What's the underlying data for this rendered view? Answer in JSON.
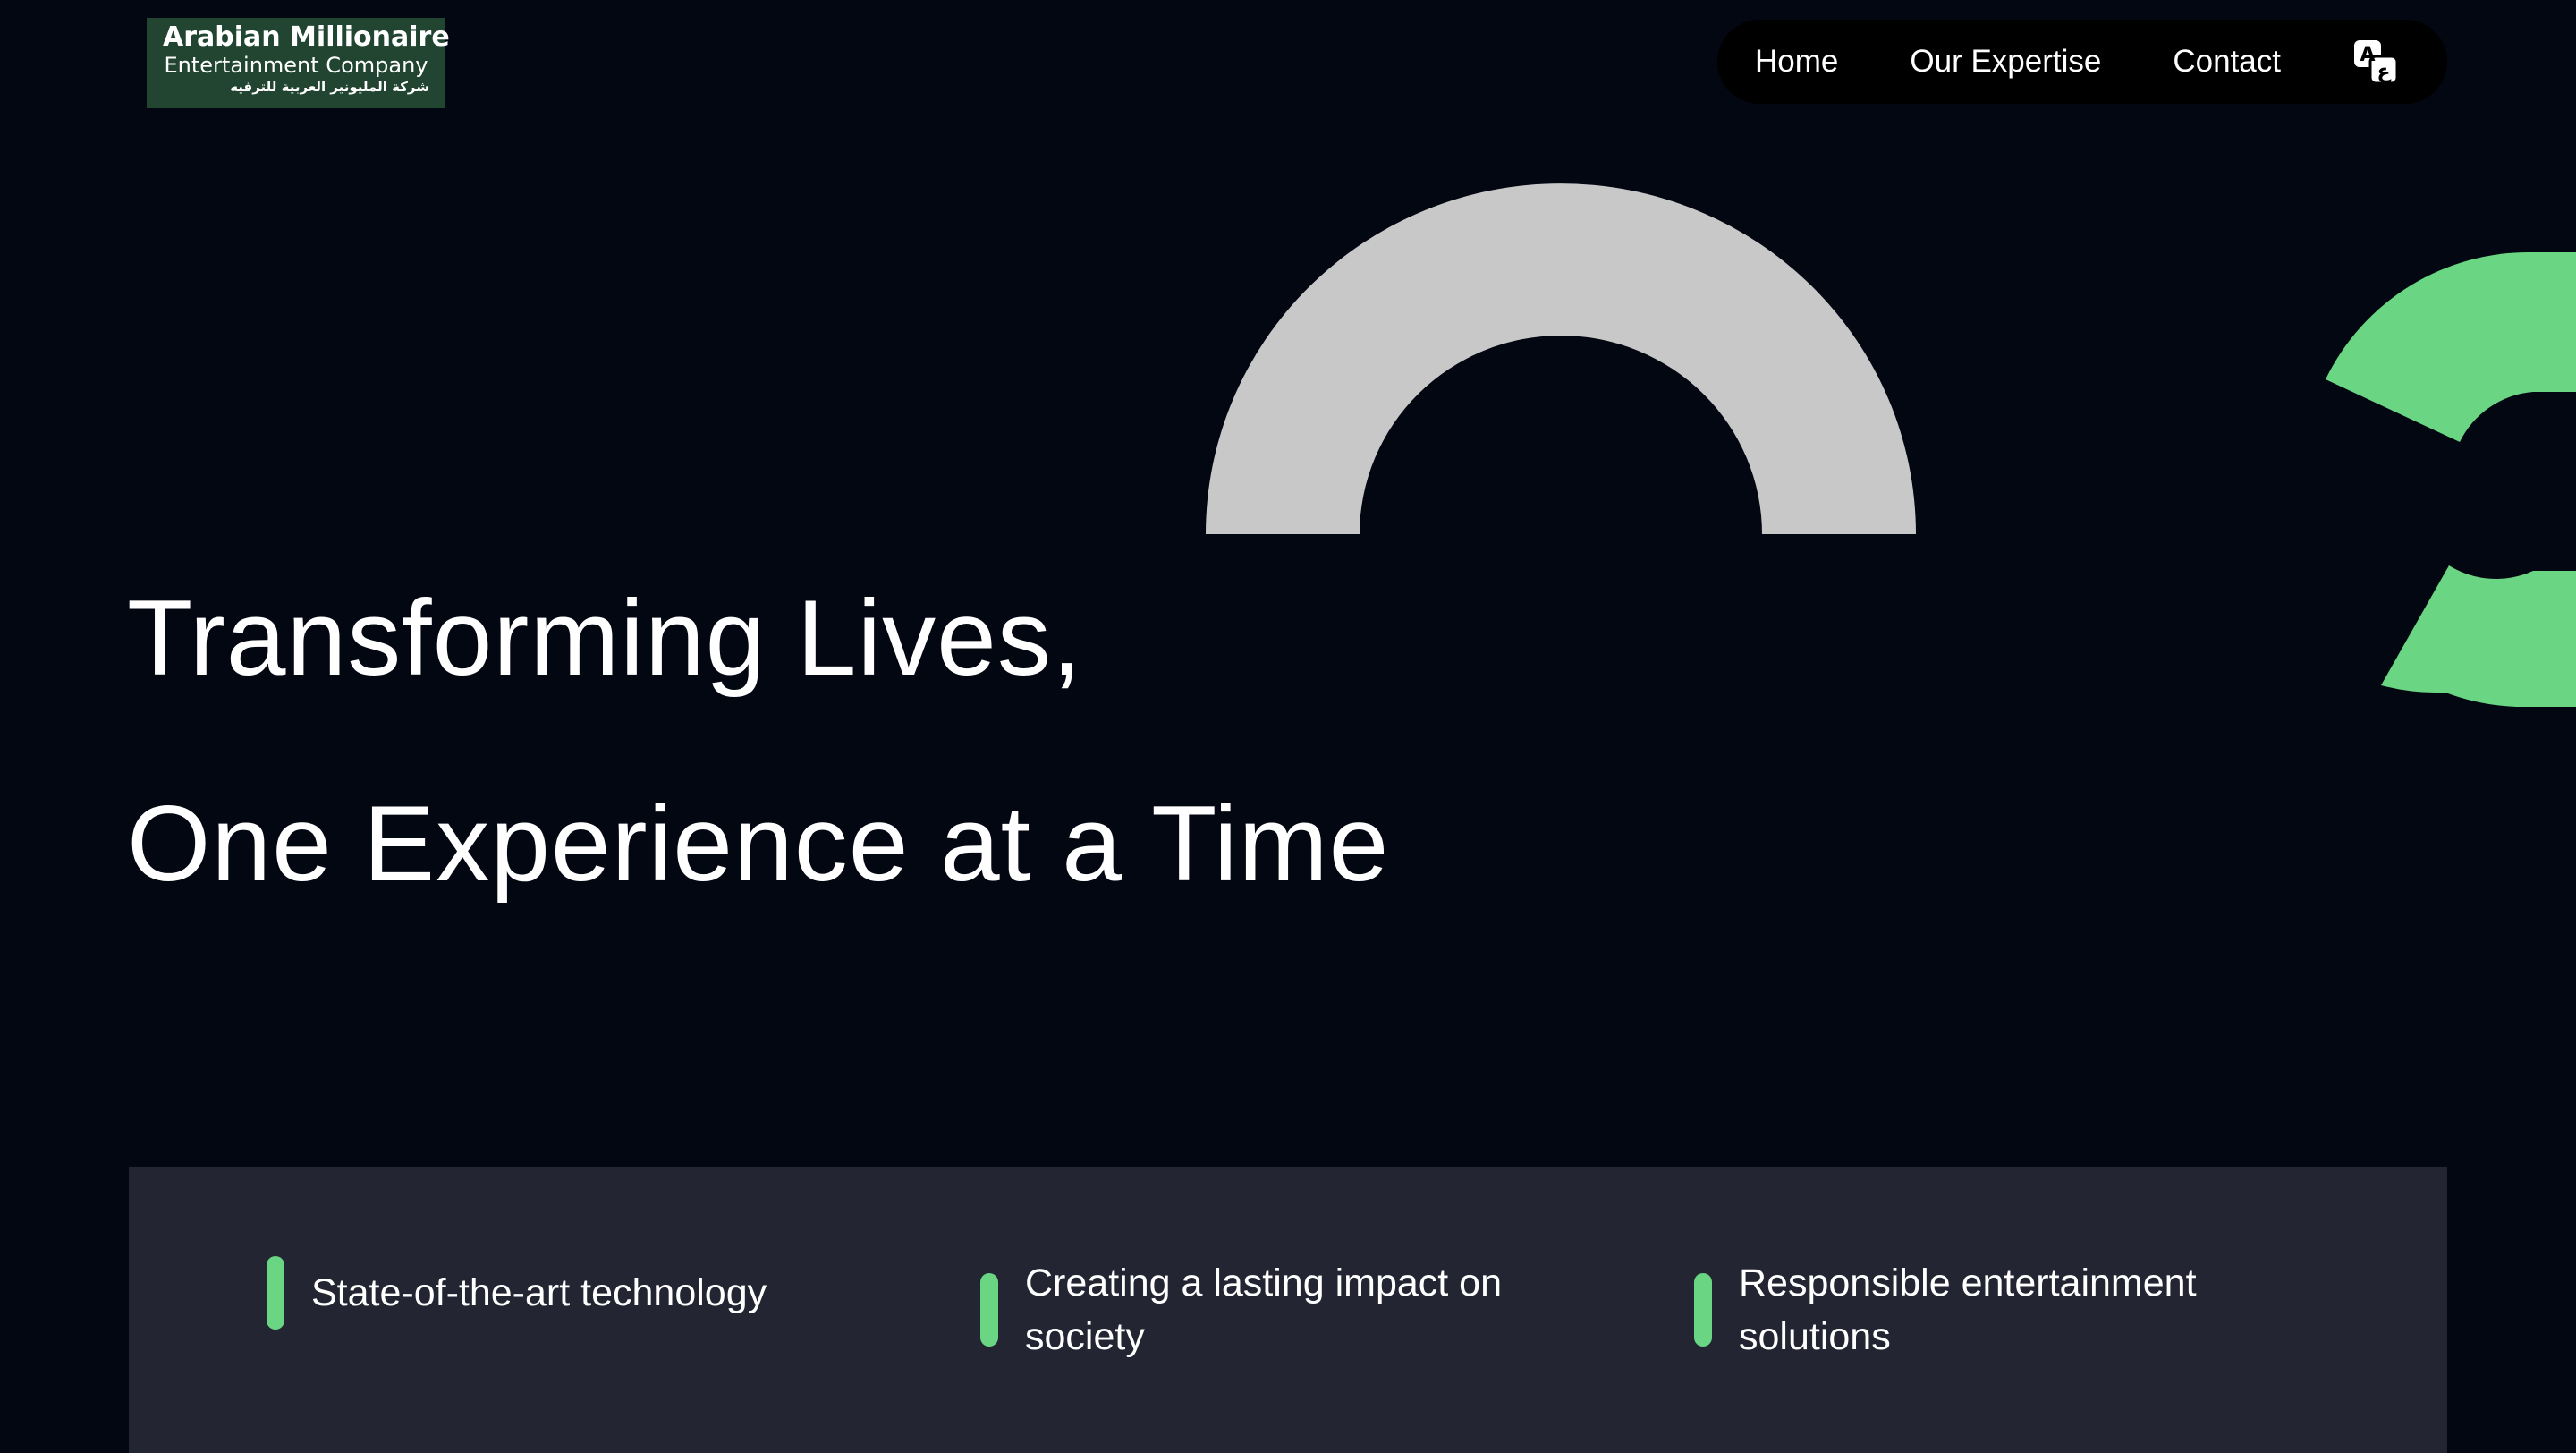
{
  "colors": {
    "background": "#030712",
    "logo_bg": "#214530",
    "nav_bg": "#000000",
    "accent_green": "#6ad583",
    "arch_gray": "#c8c8c8",
    "panel_bg": "#232632",
    "text": "#ffffff"
  },
  "header": {
    "logo": {
      "line1": "Arabian Millionaire",
      "line2": "Entertainment Company",
      "line3": "شركة المليونير العربية للترفيه"
    },
    "nav": {
      "items": [
        {
          "label": "Home"
        },
        {
          "label": "Our Expertise"
        },
        {
          "label": "Contact"
        }
      ],
      "language_toggle": {
        "icon": "language-translate-icon",
        "glyph_latin": "A",
        "glyph_arabic": "ع"
      }
    }
  },
  "hero": {
    "line1": "Transforming Lives,",
    "line2": "One Experience at a Time"
  },
  "features": {
    "items": [
      {
        "text": "State-of-the-art technology"
      },
      {
        "text": "Creating a lasting impact on society"
      },
      {
        "text": "Responsible entertainment solutions"
      }
    ]
  }
}
